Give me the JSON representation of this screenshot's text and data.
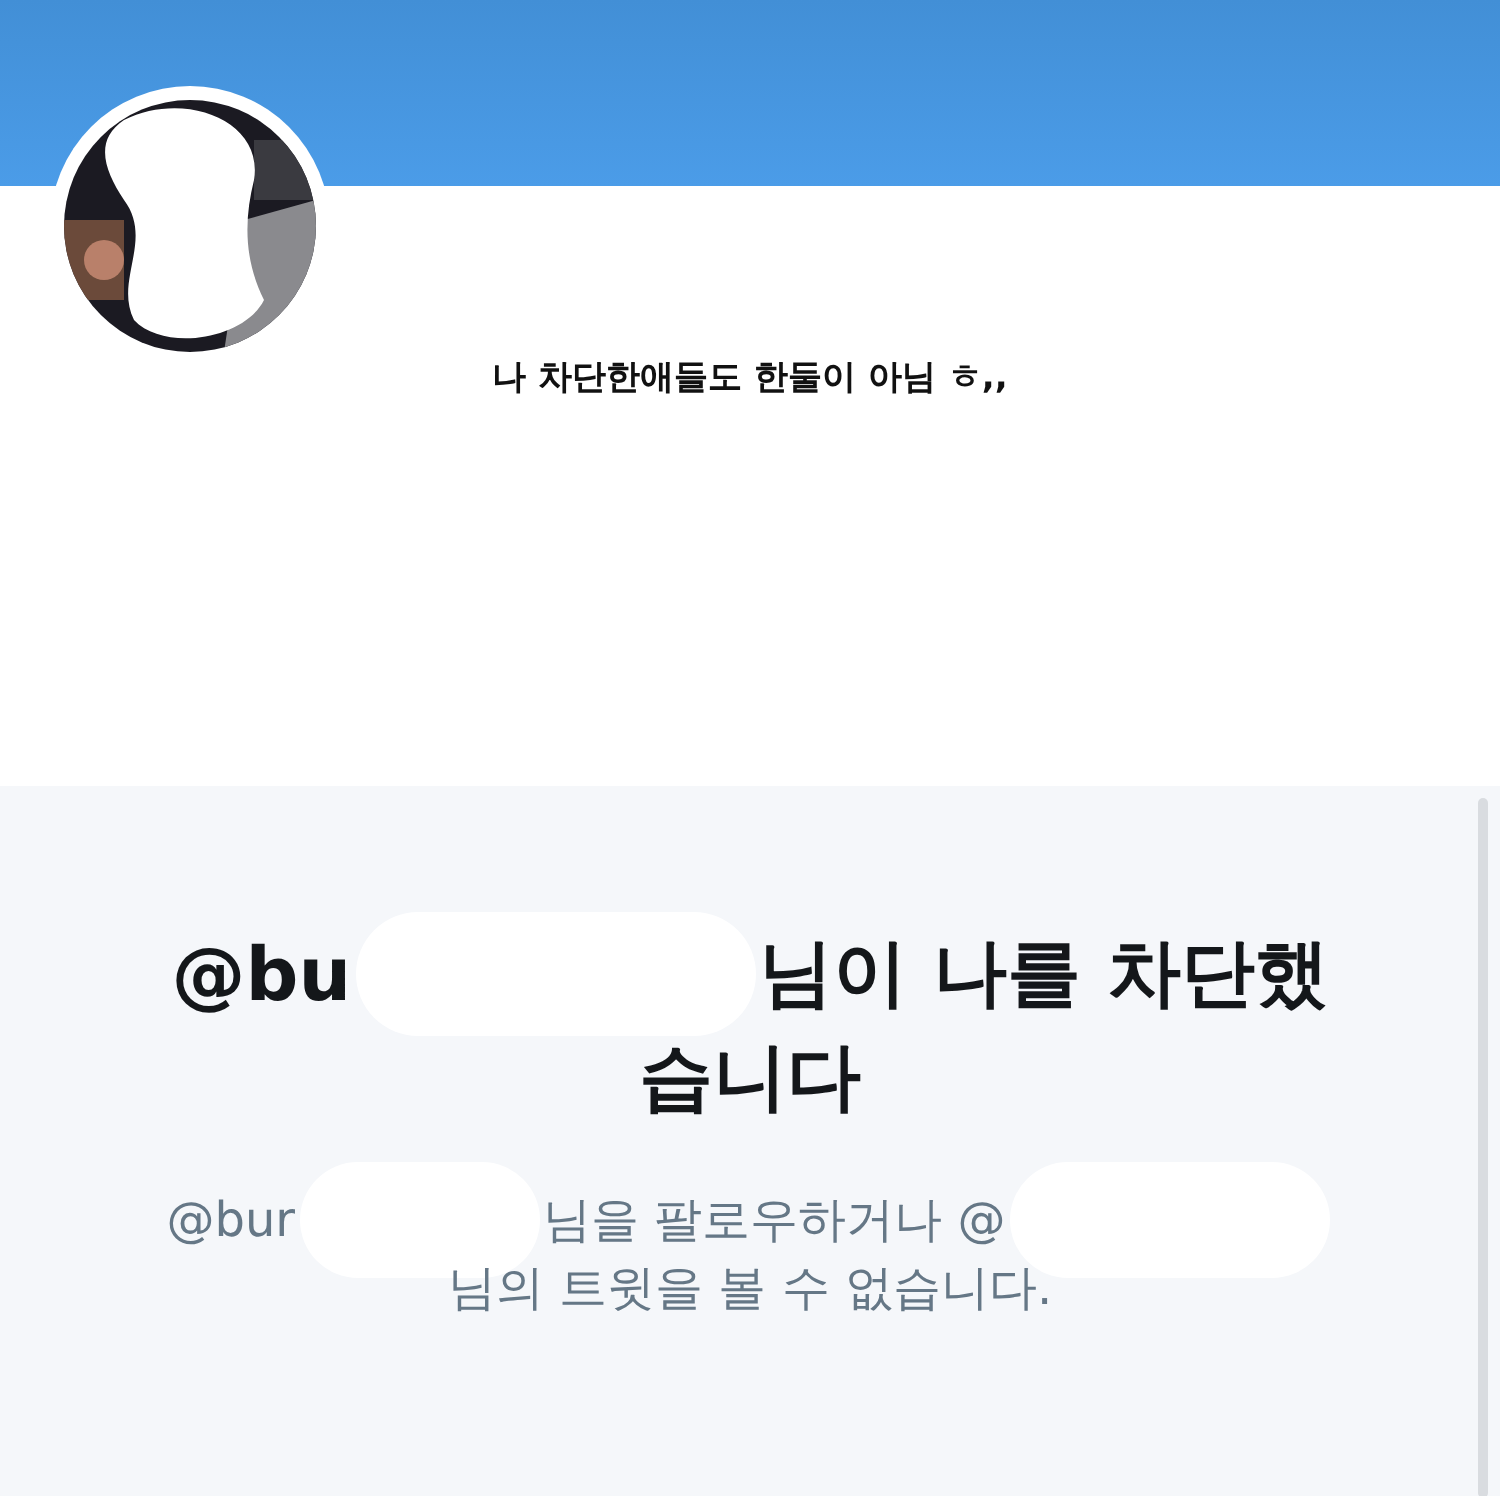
{
  "profile": {
    "bio": "나 차단한애들도 한둘이 아님 ㅎ,,"
  },
  "blocked_notice": {
    "heading_lines": [
      [
        {
          "kind": "text",
          "text": "@bu"
        },
        {
          "kind": "redaction"
        },
        {
          "kind": "text",
          "text": "님이 나를 차단했"
        }
      ],
      [
        {
          "kind": "text",
          "text": "습니다"
        }
      ]
    ],
    "body_lines": [
      [
        {
          "kind": "text",
          "text": "@bur"
        },
        {
          "kind": "redaction"
        },
        {
          "kind": "text",
          "text": "님을 팔로우하거나 @"
        },
        {
          "kind": "redaction"
        }
      ],
      [
        {
          "kind": "text",
          "text": "님의 트윗을 볼 수 없습니다."
        }
      ]
    ]
  }
}
